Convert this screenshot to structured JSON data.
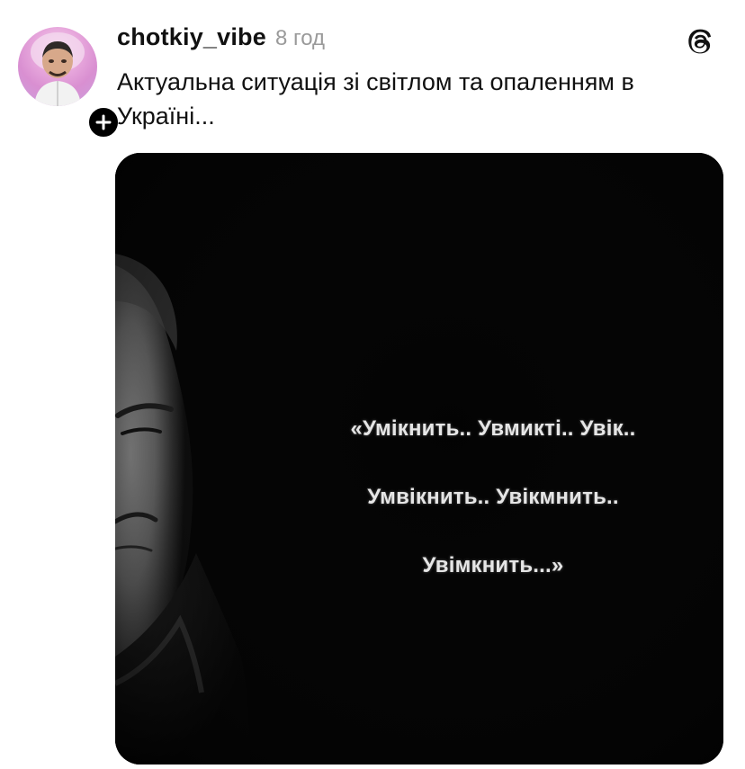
{
  "post": {
    "username": "chotkiy_vibe",
    "time": "8 год",
    "caption": "Актуальна ситуація зі світлом та опаленням в Україні...",
    "app_icon": "threads-logo-icon",
    "follow_icon": "plus-icon"
  },
  "media": {
    "quote_lines": [
      "«Умікнить.. Увмикті.. Увік..",
      "Умвікнить.. Увікмнить..",
      "Увімкнить...»"
    ]
  },
  "colors": {
    "text": "#111111",
    "muted": "#9a9a9a",
    "media_bg": "#000000",
    "quote": "#e6e6e6"
  }
}
